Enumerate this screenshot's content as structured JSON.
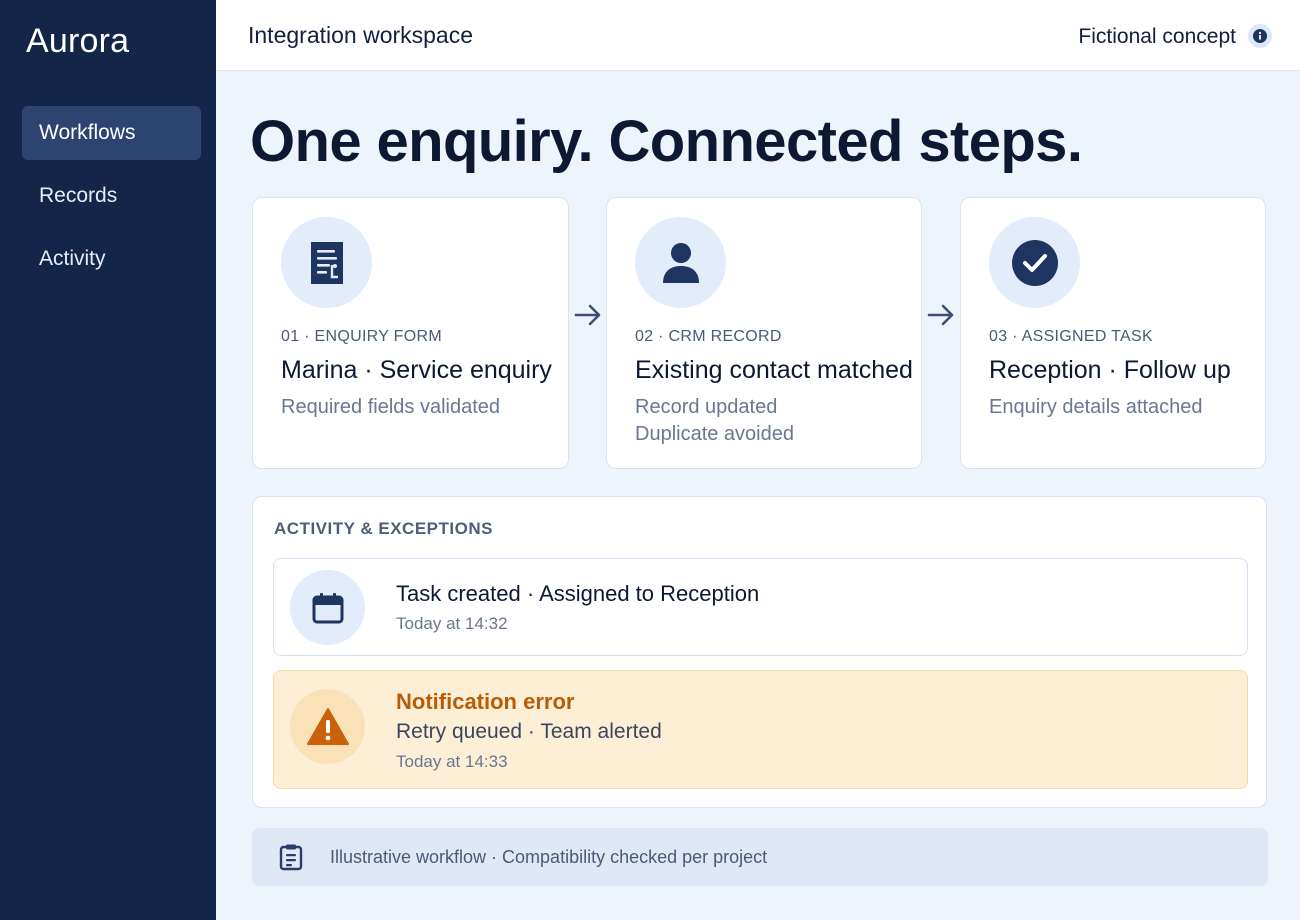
{
  "sidebar": {
    "brand": "Aurora",
    "items": [
      {
        "label": "Workflows",
        "active": true
      },
      {
        "label": "Records",
        "active": false
      },
      {
        "label": "Activity",
        "active": false
      }
    ]
  },
  "topbar": {
    "title": "Integration workspace",
    "note": "Fictional concept",
    "info_icon": "info-icon"
  },
  "main": {
    "headline": "One enquiry. Connected steps.",
    "steps": [
      {
        "icon": "form-document-icon",
        "tag": "01 · ENQUIRY FORM",
        "title": "Marina · Service enquiry",
        "sub": [
          "Required fields validated"
        ]
      },
      {
        "icon": "person-icon",
        "tag": "02 · CRM RECORD",
        "title": "Existing contact matched",
        "sub": [
          "Record updated",
          "Duplicate avoided"
        ]
      },
      {
        "icon": "check-circle-icon",
        "tag": "03 · ASSIGNED TASK",
        "title": "Reception · Follow up",
        "sub": [
          "Enquiry details attached"
        ]
      }
    ],
    "activity": {
      "heading": "ACTIVITY & EXCEPTIONS",
      "items": [
        {
          "icon": "calendar-icon",
          "title": "Task created · Assigned to Reception",
          "time": "Today at 14:32"
        },
        {
          "icon": "warning-icon",
          "title": "Notification error",
          "detail": "Retry queued · Team alerted",
          "time": "Today at 14:33"
        }
      ]
    },
    "footer": {
      "icon": "clipboard-icon",
      "text": "Illustrative workflow · Compatibility checked per project"
    }
  },
  "colors": {
    "sidebar": "#14254a",
    "sidebar_active": "#2d4471",
    "accent_navy": "#1e3461",
    "background": "#eef4fc",
    "warning_bg": "#fdefd6",
    "warning_text": "#b85c06"
  }
}
